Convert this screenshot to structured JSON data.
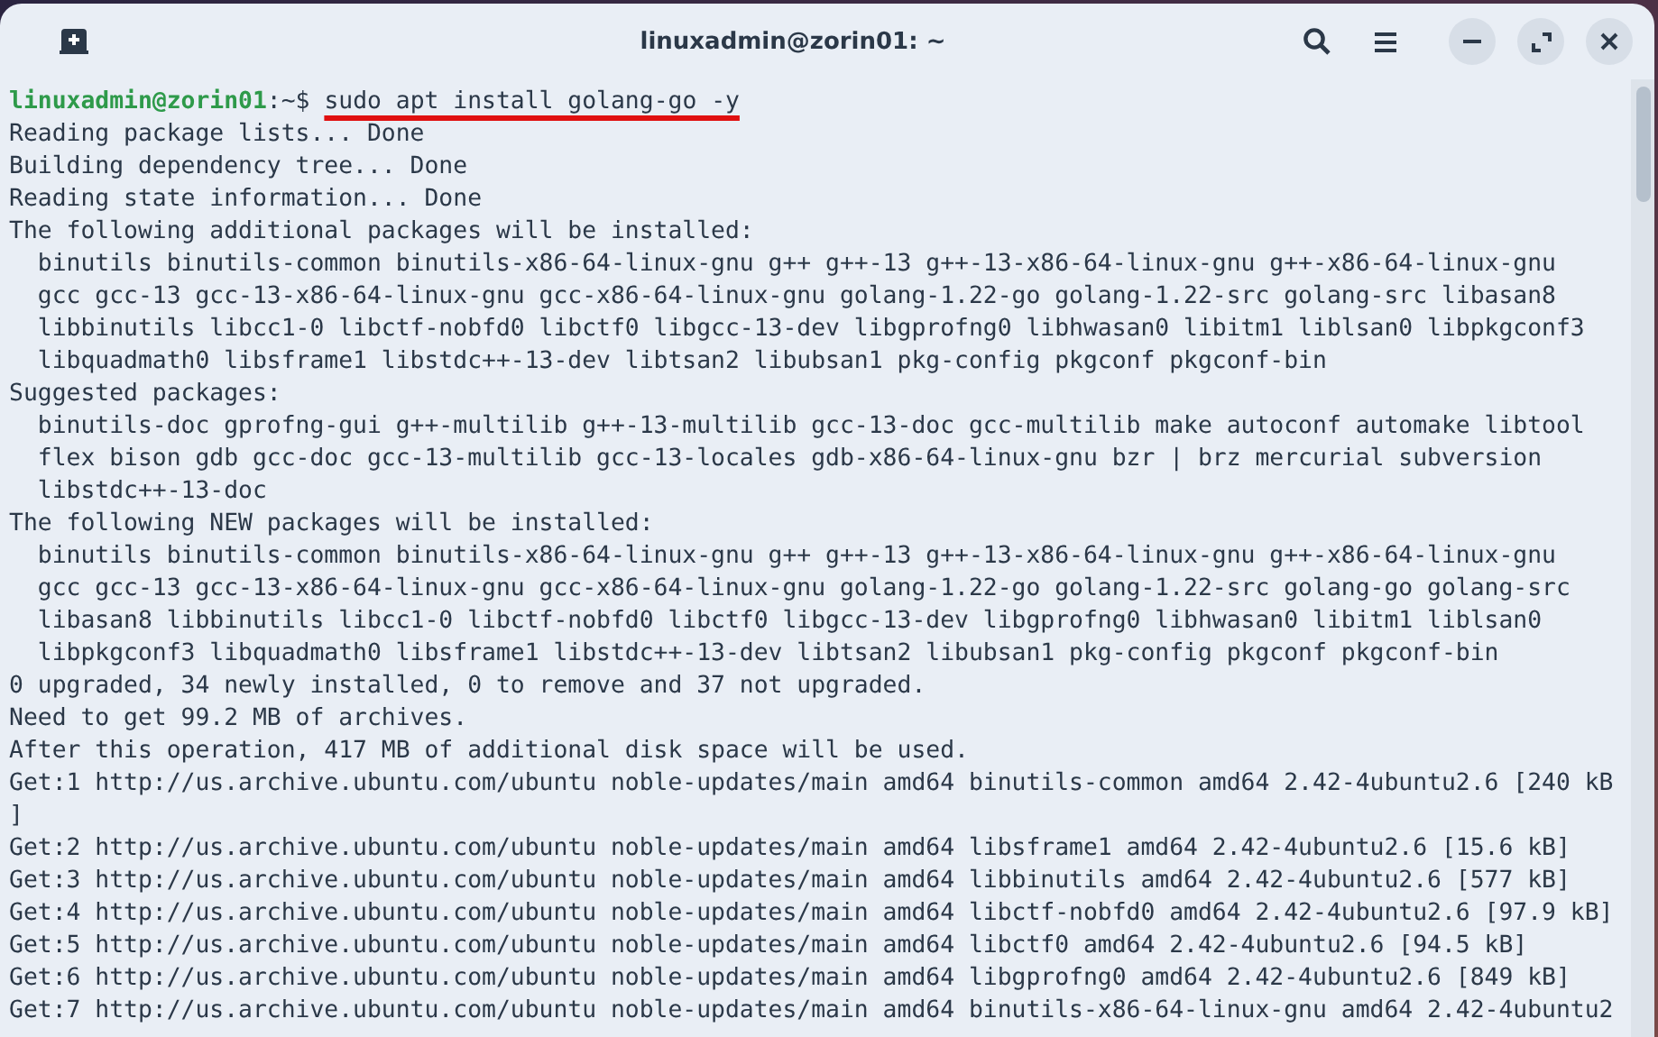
{
  "window": {
    "title": "linuxadmin@zorin01: ~"
  },
  "prompt": {
    "user_host": "linuxadmin@zorin01",
    "path": ":~$",
    "command": "sudo apt install golang-go -y",
    "highlighted": true
  },
  "lines": [
    "Reading package lists... Done",
    "Building dependency tree... Done",
    "Reading state information... Done",
    "The following additional packages will be installed:",
    "  binutils binutils-common binutils-x86-64-linux-gnu g++ g++-13 g++-13-x86-64-linux-gnu g++-x86-64-linux-gnu",
    "  gcc gcc-13 gcc-13-x86-64-linux-gnu gcc-x86-64-linux-gnu golang-1.22-go golang-1.22-src golang-src libasan8",
    "  libbinutils libcc1-0 libctf-nobfd0 libctf0 libgcc-13-dev libgprofng0 libhwasan0 libitm1 liblsan0 libpkgconf3",
    "  libquadmath0 libsframe1 libstdc++-13-dev libtsan2 libubsan1 pkg-config pkgconf pkgconf-bin",
    "Suggested packages:",
    "  binutils-doc gprofng-gui g++-multilib g++-13-multilib gcc-13-doc gcc-multilib make autoconf automake libtool",
    "  flex bison gdb gcc-doc gcc-13-multilib gcc-13-locales gdb-x86-64-linux-gnu bzr | brz mercurial subversion",
    "  libstdc++-13-doc",
    "The following NEW packages will be installed:",
    "  binutils binutils-common binutils-x86-64-linux-gnu g++ g++-13 g++-13-x86-64-linux-gnu g++-x86-64-linux-gnu",
    "  gcc gcc-13 gcc-13-x86-64-linux-gnu gcc-x86-64-linux-gnu golang-1.22-go golang-1.22-src golang-go golang-src",
    "  libasan8 libbinutils libcc1-0 libctf-nobfd0 libctf0 libgcc-13-dev libgprofng0 libhwasan0 libitm1 liblsan0",
    "  libpkgconf3 libquadmath0 libsframe1 libstdc++-13-dev libtsan2 libubsan1 pkg-config pkgconf pkgconf-bin",
    "0 upgraded, 34 newly installed, 0 to remove and 37 not upgraded.",
    "Need to get 99.2 MB of archives.",
    "After this operation, 417 MB of additional disk space will be used.",
    "Get:1 http://us.archive.ubuntu.com/ubuntu noble-updates/main amd64 binutils-common amd64 2.42-4ubuntu2.6 [240 kB",
    "]",
    "Get:2 http://us.archive.ubuntu.com/ubuntu noble-updates/main amd64 libsframe1 amd64 2.42-4ubuntu2.6 [15.6 kB]",
    "Get:3 http://us.archive.ubuntu.com/ubuntu noble-updates/main amd64 libbinutils amd64 2.42-4ubuntu2.6 [577 kB]",
    "Get:4 http://us.archive.ubuntu.com/ubuntu noble-updates/main amd64 libctf-nobfd0 amd64 2.42-4ubuntu2.6 [97.9 kB]",
    "Get:5 http://us.archive.ubuntu.com/ubuntu noble-updates/main amd64 libctf0 amd64 2.42-4ubuntu2.6 [94.5 kB]",
    "Get:6 http://us.archive.ubuntu.com/ubuntu noble-updates/main amd64 libgprofng0 amd64 2.42-4ubuntu2.6 [849 kB]",
    "Get:7 http://us.archive.ubuntu.com/ubuntu noble-updates/main amd64 binutils-x86-64-linux-gnu amd64 2.42-4ubuntu2"
  ]
}
